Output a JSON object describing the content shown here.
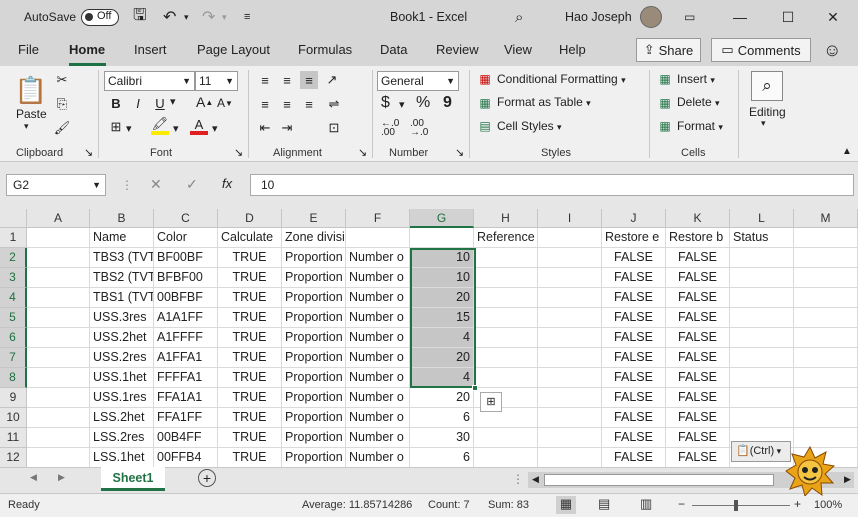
{
  "titlebar": {
    "autosave_label": "AutoSave",
    "autosave_state": "Off",
    "doc_title": "Book1 - Excel",
    "user_name": "Hao Joseph"
  },
  "menu": {
    "tabs": [
      "File",
      "Home",
      "Insert",
      "Page Layout",
      "Formulas",
      "Data",
      "Review",
      "View",
      "Help"
    ],
    "active_tab": "Home",
    "share_label": "Share",
    "comments_label": "Comments"
  },
  "ribbon": {
    "clipboard": {
      "paste_label": "Paste",
      "group_label": "Clipboard"
    },
    "font": {
      "font_name": "Calibri",
      "font_size": "11",
      "group_label": "Font",
      "bold": "B",
      "italic": "I",
      "underline": "U"
    },
    "alignment": {
      "group_label": "Alignment"
    },
    "number": {
      "format": "General",
      "group_label": "Number",
      "currency": "$",
      "percent": "%",
      "comma": "9"
    },
    "styles": {
      "conditional": "Conditional Formatting",
      "table": "Format as Table",
      "cell_styles": "Cell Styles",
      "group_label": "Styles"
    },
    "cells": {
      "insert": "Insert",
      "delete": "Delete",
      "format": "Format",
      "group_label": "Cells"
    },
    "editing": {
      "label": "Editing"
    }
  },
  "formula_bar": {
    "name_box": "G2",
    "formula": "10",
    "fx": "fx"
  },
  "sheet": {
    "columns": [
      "A",
      "B",
      "C",
      "D",
      "E",
      "F",
      "G",
      "H",
      "I",
      "J",
      "K",
      "L",
      "M"
    ],
    "rows": [
      {
        "num": "1",
        "B": "Name",
        "C": "Color",
        "D": "Calculate",
        "E": "Zone division",
        "F": "",
        "G": "",
        "H": "Reference surface",
        "I": "",
        "J": "Restore e",
        "K": "Restore b",
        "L": "Status"
      },
      {
        "num": "2",
        "B": "TBS3 (TVT",
        "C": "BF00BF",
        "D": "TRUE",
        "E": "Proportion",
        "F": "Number o",
        "G": "10",
        "H": "",
        "I": "",
        "J": "FALSE",
        "K": "FALSE",
        "L": ""
      },
      {
        "num": "3",
        "B": "TBS2 (TVT",
        "C": "BFBF00",
        "D": "TRUE",
        "E": "Proportion",
        "F": "Number o",
        "G": "10",
        "H": "",
        "I": "",
        "J": "FALSE",
        "K": "FALSE",
        "L": ""
      },
      {
        "num": "4",
        "B": "TBS1 (TVT",
        "C": "00BFBF",
        "D": "TRUE",
        "E": "Proportion",
        "F": "Number o",
        "G": "20",
        "H": "",
        "I": "",
        "J": "FALSE",
        "K": "FALSE",
        "L": ""
      },
      {
        "num": "5",
        "B": "USS.3res",
        "C": "A1A1FF",
        "D": "TRUE",
        "E": "Proportion",
        "F": "Number o",
        "G": "15",
        "H": "",
        "I": "",
        "J": "FALSE",
        "K": "FALSE",
        "L": ""
      },
      {
        "num": "6",
        "B": "USS.2het",
        "C": "A1FFFF",
        "D": "TRUE",
        "E": "Proportion",
        "F": "Number o",
        "G": "4",
        "H": "",
        "I": "",
        "J": "FALSE",
        "K": "FALSE",
        "L": ""
      },
      {
        "num": "7",
        "B": "USS.2res",
        "C": "A1FFA1",
        "D": "TRUE",
        "E": "Proportion",
        "F": "Number o",
        "G": "20",
        "H": "",
        "I": "",
        "J": "FALSE",
        "K": "FALSE",
        "L": ""
      },
      {
        "num": "8",
        "B": "USS.1het",
        "C": "FFFFA1",
        "D": "TRUE",
        "E": "Proportion",
        "F": "Number o",
        "G": "4",
        "H": "",
        "I": "",
        "J": "FALSE",
        "K": "FALSE",
        "L": ""
      },
      {
        "num": "9",
        "B": "USS.1res",
        "C": "FFA1A1",
        "D": "TRUE",
        "E": "Proportion",
        "F": "Number o",
        "G": "20",
        "H": "",
        "I": "",
        "J": "FALSE",
        "K": "FALSE",
        "L": ""
      },
      {
        "num": "10",
        "B": "LSS.2het",
        "C": "FFA1FF",
        "D": "TRUE",
        "E": "Proportion",
        "F": "Number o",
        "G": "6",
        "H": "",
        "I": "",
        "J": "FALSE",
        "K": "FALSE",
        "L": ""
      },
      {
        "num": "11",
        "B": "LSS.2res",
        "C": "00B4FF",
        "D": "TRUE",
        "E": "Proportion",
        "F": "Number o",
        "G": "30",
        "H": "",
        "I": "",
        "J": "FALSE",
        "K": "FALSE",
        "L": ""
      },
      {
        "num": "12",
        "B": "LSS.1het",
        "C": "00FFB4",
        "D": "TRUE",
        "E": "Proportion",
        "F": "Number o",
        "G": "6",
        "H": "",
        "I": "",
        "J": "FALSE",
        "K": "FALSE",
        "L": ""
      }
    ],
    "paste_popup": "(Ctrl)"
  },
  "sheet_tabs": {
    "active": "Sheet1"
  },
  "status": {
    "ready": "Ready",
    "average": "Average: 11.85714286",
    "count": "Count: 7",
    "sum": "Sum: 83",
    "zoom": "100%"
  },
  "colors": {
    "accent": "#217346",
    "selection": "#c6c6c6"
  }
}
